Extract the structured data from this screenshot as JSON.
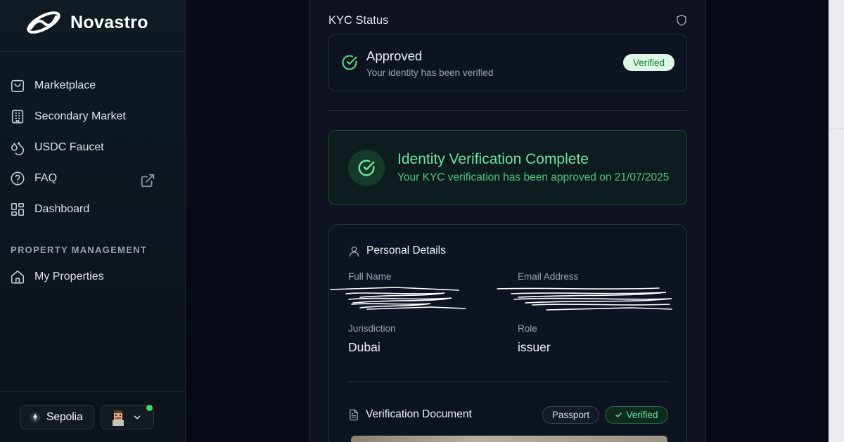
{
  "brand": {
    "name": "Novastro"
  },
  "sidebar": {
    "items": [
      {
        "label": "Marketplace",
        "icon": "shopping-bag-icon"
      },
      {
        "label": "Secondary Market",
        "icon": "building-icon"
      },
      {
        "label": "USDC Faucet",
        "icon": "droplets-icon"
      },
      {
        "label": "FAQ",
        "icon": "help-circle-icon",
        "external": true
      },
      {
        "label": "Dashboard",
        "icon": "layout-grid-icon"
      }
    ],
    "section_title": "PROPERTY MANAGEMENT",
    "section_items": [
      {
        "label": "My Properties",
        "icon": "home-icon"
      }
    ]
  },
  "footer": {
    "network_label": "Sepolia",
    "network_icon": "ethereum-icon",
    "account_status_color": "#3ddc5e"
  },
  "kyc": {
    "title": "KYC Status",
    "status_title": "Approved",
    "status_sub": "Your identity has been verified",
    "status_badge": "Verified"
  },
  "verification": {
    "title": "Identity Verification Complete",
    "subtitle": "Your KYC verification has been approved on 21/07/2025"
  },
  "personal": {
    "title": "Personal Details",
    "full_name_label": "Full Name",
    "email_label": "Email Address",
    "jurisdiction_label": "Jurisdiction",
    "jurisdiction_value": "Dubai",
    "role_label": "Role",
    "role_value": "issuer"
  },
  "document": {
    "title": "Verification Document",
    "type": "Passport",
    "status": "Verified"
  },
  "colors": {
    "accent_green": "#6fe3a0",
    "badge_bg": "#ddf7e4",
    "badge_text": "#137a34",
    "background": "#080a17"
  }
}
